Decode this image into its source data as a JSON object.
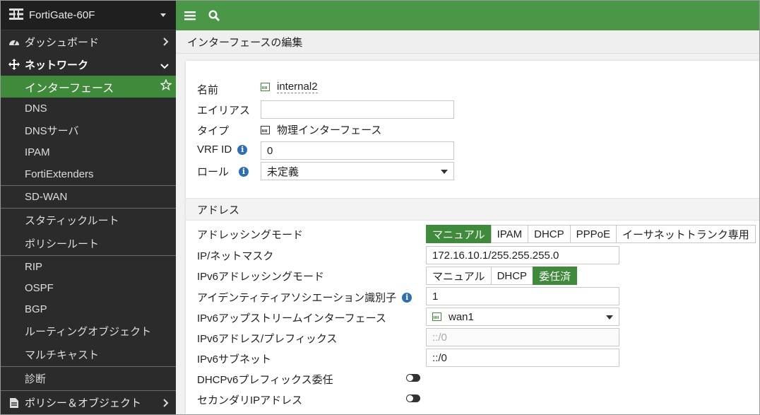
{
  "app": {
    "device_name": "FortiGate-60F"
  },
  "sidebar": {
    "items": [
      {
        "label": "ダッシュボード",
        "icon": "gauge-icon"
      },
      {
        "label": "ネットワーク",
        "icon": "move-arrows-icon"
      }
    ],
    "network_children": [
      {
        "label": "インターフェース",
        "active": true
      },
      {
        "label": "DNS"
      },
      {
        "label": "DNSサーバ"
      },
      {
        "label": "IPAM"
      },
      {
        "label": "FortiExtenders"
      },
      {
        "label": "SD-WAN"
      },
      {
        "label": "スタティックルート"
      },
      {
        "label": "ポリシールート"
      },
      {
        "label": "RIP"
      },
      {
        "label": "OSPF"
      },
      {
        "label": "BGP"
      },
      {
        "label": "ルーティングオブジェクト"
      },
      {
        "label": "マルチキャスト"
      },
      {
        "label": "診断"
      }
    ],
    "bottom_item": {
      "label": "ポリシー＆オブジェクト",
      "icon": "document-icon"
    }
  },
  "page": {
    "title": "インターフェースの編集"
  },
  "form": {
    "name_label": "名前",
    "name_value": "internal2",
    "alias_label": "エイリアス",
    "alias_value": "",
    "type_label": "タイプ",
    "type_value": "物理インターフェース",
    "vrf_label": "VRF ID",
    "vrf_value": "0",
    "role_label": "ロール",
    "role_value": "未定義"
  },
  "address": {
    "section_title": "アドレス",
    "mode_label": "アドレッシングモード",
    "mode_options": [
      "マニュアル",
      "IPAM",
      "DHCP",
      "PPPoE",
      "イーサネットトランク専用"
    ],
    "mode_selected": "マニュアル",
    "ip_label": "IP/ネットマスク",
    "ip_value": "172.16.10.1/255.255.255.0",
    "ipv6_mode_label": "IPv6アドレッシングモード",
    "ipv6_mode_options": [
      "マニュアル",
      "DHCP",
      "委任済"
    ],
    "ipv6_mode_selected": "委任済",
    "identity_label": "アイデンティティアソシエーション識別子",
    "identity_value": "1",
    "upstream_label": "IPv6アップストリームインターフェース",
    "upstream_value": "wan1",
    "ipv6_prefix_label": "IPv6アドレス/プレフィックス",
    "ipv6_prefix_value": "::/0",
    "ipv6_subnet_label": "IPv6サブネット",
    "ipv6_subnet_value": "::/0",
    "dhcpv6_label": "DHCPv6プレフィックス委任",
    "dhcpv6_enabled": false,
    "secondary_label": "セカンダリIPアドレス",
    "secondary_enabled": false
  },
  "colors": {
    "accent": "#3f8b3b",
    "topbar": "#4a9748",
    "sidebar": "#2b2b2b",
    "info": "#2d6fb0"
  }
}
